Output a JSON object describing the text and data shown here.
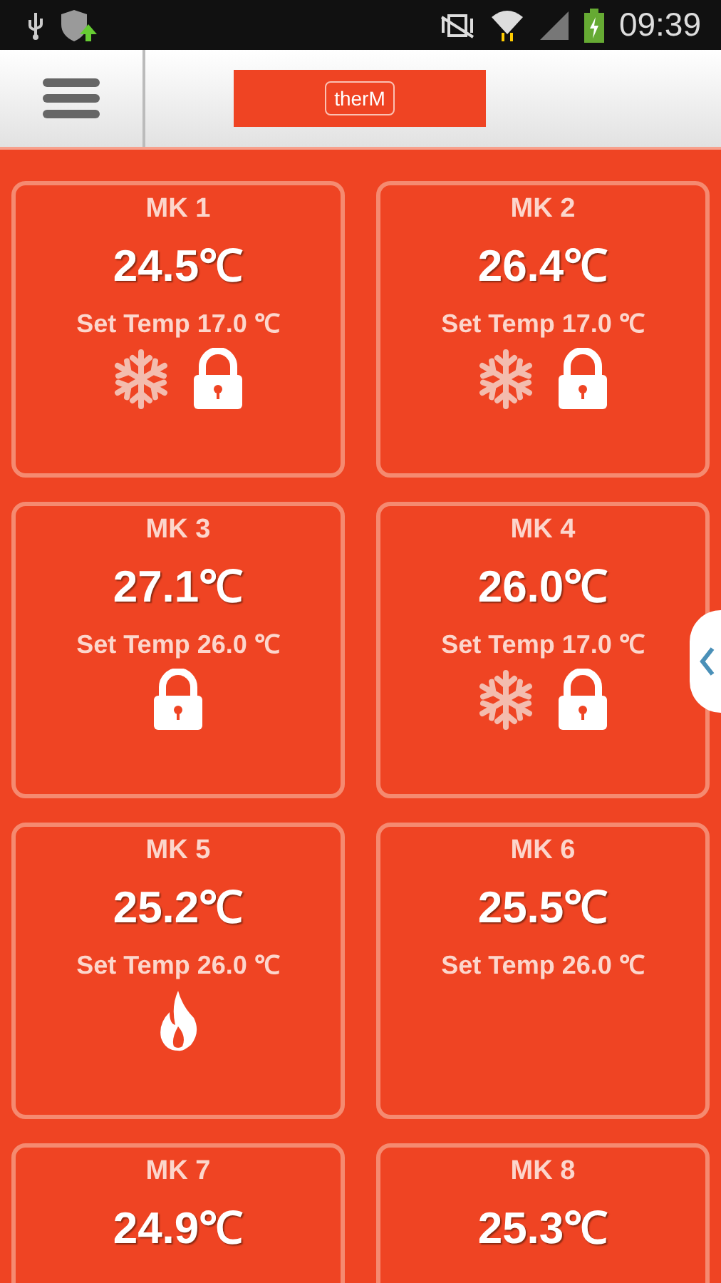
{
  "status_bar": {
    "time": "09:39"
  },
  "header": {
    "logo": "therM"
  },
  "zones": [
    {
      "name": "MK 1",
      "temperature": "24.5℃",
      "set_temp": "Set Temp 17.0 ℃",
      "cooling": true,
      "locked": true,
      "heating": false
    },
    {
      "name": "MK 2",
      "temperature": "26.4℃",
      "set_temp": "Set Temp 17.0 ℃",
      "cooling": true,
      "locked": true,
      "heating": false
    },
    {
      "name": "MK 3",
      "temperature": "27.1℃",
      "set_temp": "Set Temp 26.0 ℃",
      "cooling": false,
      "locked": true,
      "heating": false
    },
    {
      "name": "MK 4",
      "temperature": "26.0℃",
      "set_temp": "Set Temp 17.0 ℃",
      "cooling": true,
      "locked": true,
      "heating": false
    },
    {
      "name": "MK 5",
      "temperature": "25.2℃",
      "set_temp": "Set Temp 26.0 ℃",
      "cooling": false,
      "locked": false,
      "heating": true
    },
    {
      "name": "MK 6",
      "temperature": "25.5℃",
      "set_temp": "Set Temp 26.0 ℃",
      "cooling": false,
      "locked": false,
      "heating": false
    },
    {
      "name": "MK 7",
      "temperature": "24.9℃"
    },
    {
      "name": "MK 8",
      "temperature": "25.3℃"
    }
  ]
}
